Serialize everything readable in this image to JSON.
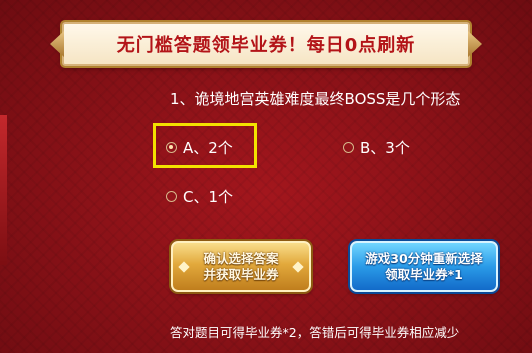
{
  "banner": {
    "title": "无门槛答题领毕业券！每日0点刷新"
  },
  "question": {
    "text": "1、诡境地宫英雄难度最终BOSS是几个形态",
    "options": [
      {
        "label": "A、2个",
        "selected": true
      },
      {
        "label": "B、3个",
        "selected": false
      },
      {
        "label": "C、1个",
        "selected": false
      }
    ]
  },
  "buttons": {
    "confirm": {
      "line1": "确认选择答案",
      "line2": "并获取毕业券"
    },
    "reselect": {
      "line1": "游戏30分钟重新选择",
      "line2": "领取毕业券*1"
    }
  },
  "footnote": "答对题目可得毕业券*2，答错后可得毕业券相应减少",
  "colors": {
    "background": "#8c1218",
    "banner_text": "#b31418",
    "highlight": "#f3e200",
    "confirm_button": "#e2a93c",
    "reselect_button": "#2a9be8"
  }
}
